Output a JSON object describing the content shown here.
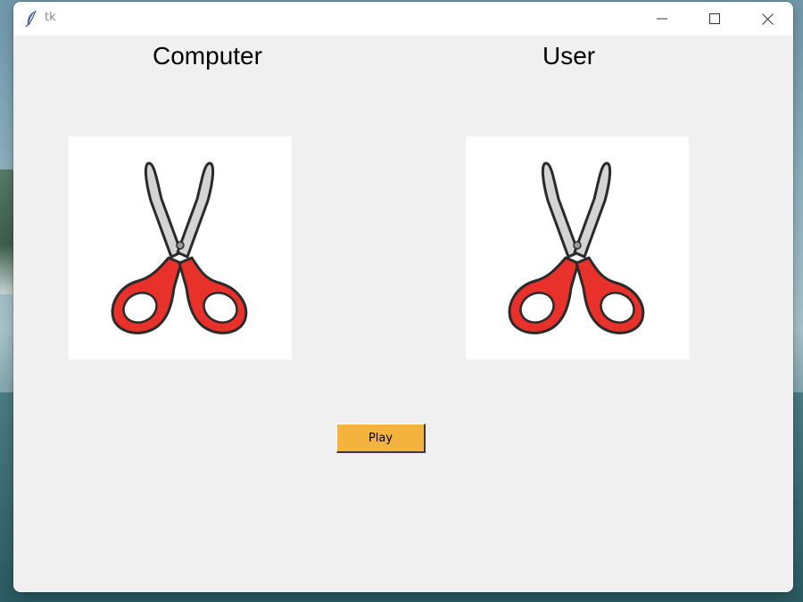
{
  "window": {
    "title": "tk",
    "icon": "feather-icon",
    "controls": [
      "minimize-icon",
      "maximize-icon",
      "close-icon"
    ]
  },
  "labels": {
    "computer": "Computer",
    "user": "User"
  },
  "choices": {
    "computer": "scissors-icon",
    "user": "scissors-icon"
  },
  "play_button": {
    "label": "Play",
    "color": "#f3b33d"
  }
}
